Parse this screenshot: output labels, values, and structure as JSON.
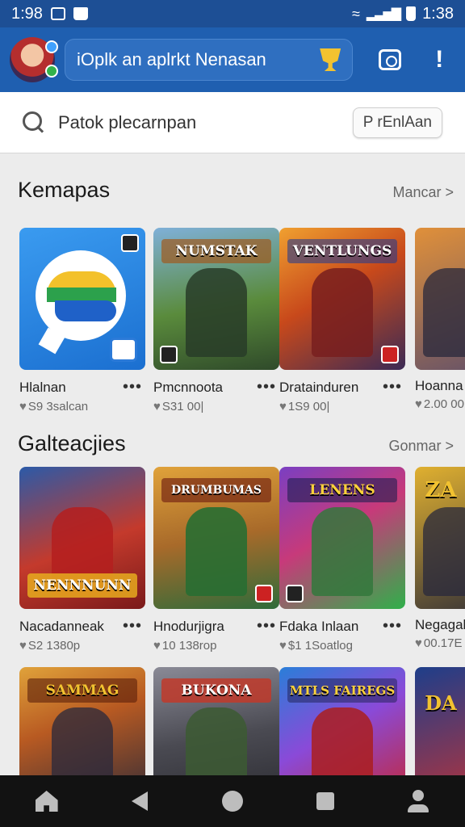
{
  "status_bar": {
    "time_left": "1:98",
    "time_right": "1:38"
  },
  "header": {
    "search_placeholder": "iOplk an aplrkt Nenasan"
  },
  "search": {
    "text": "Patok  plecarnpan",
    "button_label": "P rEnlAan"
  },
  "sections": [
    {
      "title": "Kemapas",
      "link": "Mancar >",
      "cards": [
        {
          "name": "Hlalnan",
          "meta": "S9 3salcan",
          "banner": "",
          "colors": [
            "#2e8ee8",
            "#1b6fd0"
          ]
        },
        {
          "name": "Pmcnnoota",
          "meta": "S31 00|",
          "banner": "NUMSTAK",
          "colors": [
            "#5a8b3c",
            "#2f4a2a"
          ]
        },
        {
          "name": "Dratainduren",
          "meta": "1S9 00|",
          "banner": "VENTLUNGS",
          "colors": [
            "#c8491b",
            "#3b2a55"
          ]
        },
        {
          "name": "Hoanna",
          "meta": "2.00 00|",
          "banner": "",
          "colors": [
            "#d07a2c",
            "#5a4c6c"
          ]
        }
      ]
    },
    {
      "title": "Galteacjies",
      "link": "Gonmar >",
      "cards": [
        {
          "name": "Nacadanneak",
          "meta": "S2 1380p",
          "banner": "NENNNUNN",
          "colors": [
            "#c43a2c",
            "#2b5aa8"
          ]
        },
        {
          "name": "Hnodurjigra",
          "meta": "10 138rop",
          "banner": "DRUMBUMAS",
          "colors": [
            "#e0a23a",
            "#2f6b3a"
          ]
        },
        {
          "name": "Fdaka Inlaan",
          "meta": "$1 1Soatlog",
          "banner": "LENENS",
          "colors": [
            "#7a3fc2",
            "#2fb04a"
          ]
        },
        {
          "name": "Negagal",
          "meta": "00.17E",
          "banner": "ZA",
          "colors": [
            "#e0b030",
            "#2a2a38"
          ]
        }
      ]
    },
    {
      "title": "",
      "link": "",
      "cards": [
        {
          "name": "",
          "meta": "",
          "banner": "SAMMAG",
          "colors": [
            "#b85a22",
            "#2d2a38"
          ]
        },
        {
          "name": "",
          "meta": "",
          "banner": "BUKONA",
          "colors": [
            "#c13a2a",
            "#4a4a52"
          ]
        },
        {
          "name": "",
          "meta": "",
          "banner": "MTLS FAIREGS",
          "colors": [
            "#2a7ed8",
            "#c7262e"
          ]
        },
        {
          "name": "",
          "meta": "",
          "banner": "DA",
          "colors": [
            "#d0322e",
            "#1e3e8a"
          ]
        }
      ]
    }
  ]
}
